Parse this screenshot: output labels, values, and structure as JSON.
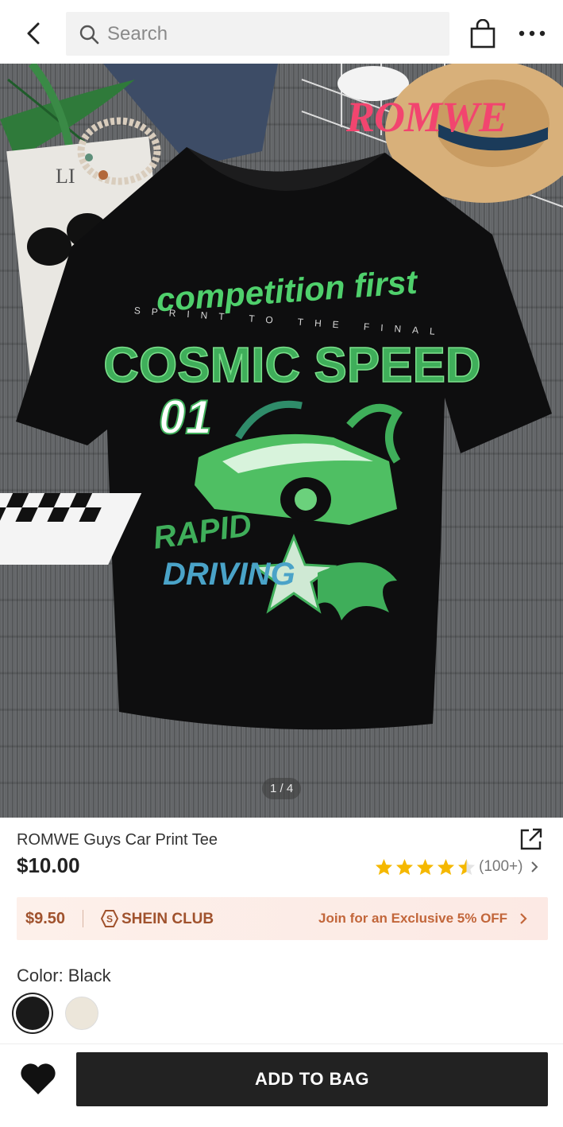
{
  "header": {
    "search_placeholder": "Search",
    "icons": [
      "back-arrow-icon",
      "search-icon",
      "shopping-bag-icon",
      "more-dots-icon"
    ]
  },
  "gallery": {
    "brand_watermark": "ROMWE",
    "image_counter": "1 / 4",
    "shirt_print": {
      "line1": "competition first",
      "line2": "SPRINT TO THE FINAL",
      "line3": "COSMIC SPEED",
      "number": "01",
      "line4": "RAPID",
      "line5": "DRIVING"
    }
  },
  "product": {
    "title": "ROMWE Guys Car Print Tee",
    "price": "$10.00",
    "rating_stars": 4.5,
    "rating_count": "(100+)"
  },
  "club": {
    "price": "$9.50",
    "name": "SHEIN CLUB",
    "cta": "Join for an Exclusive 5% OFF"
  },
  "color": {
    "label": "Color: Black",
    "options": [
      {
        "name": "Black",
        "hex": "#1a1a1a",
        "selected": true
      },
      {
        "name": "Beige",
        "hex": "#ece6da",
        "selected": false
      }
    ]
  },
  "actions": {
    "add_to_bag": "ADD TO BAG"
  },
  "colors": {
    "accent_club": "#a0522d",
    "star": "#f5b800",
    "brand_pink": "#f2456f",
    "print_green": "#3fae5a"
  }
}
